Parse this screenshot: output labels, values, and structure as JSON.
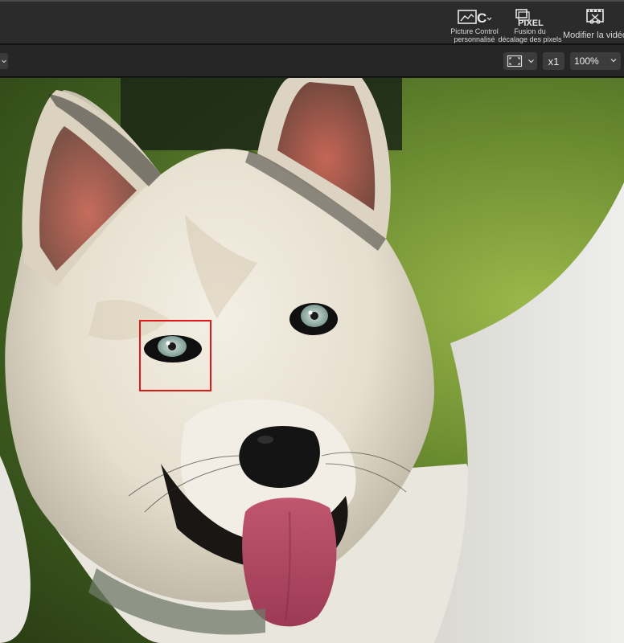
{
  "toolbar": {
    "picture_control": {
      "line1": "Picture Control",
      "line2": "personnalisé",
      "icon": "picture-control-icon"
    },
    "pixel_shift": {
      "line1": "Fusion du",
      "line2": "décalage des pixels",
      "icon": "pixel-shift-icon"
    },
    "edit_video": {
      "label": "Modifier la vidéo",
      "icon": "video-edit-icon"
    }
  },
  "viewbar": {
    "fit_icon": "fit-to-screen-icon",
    "multiplier_label": "x1",
    "zoom_value": "100%"
  },
  "viewer": {
    "subject": "photo",
    "focus_indicator_color": "#e01818"
  }
}
